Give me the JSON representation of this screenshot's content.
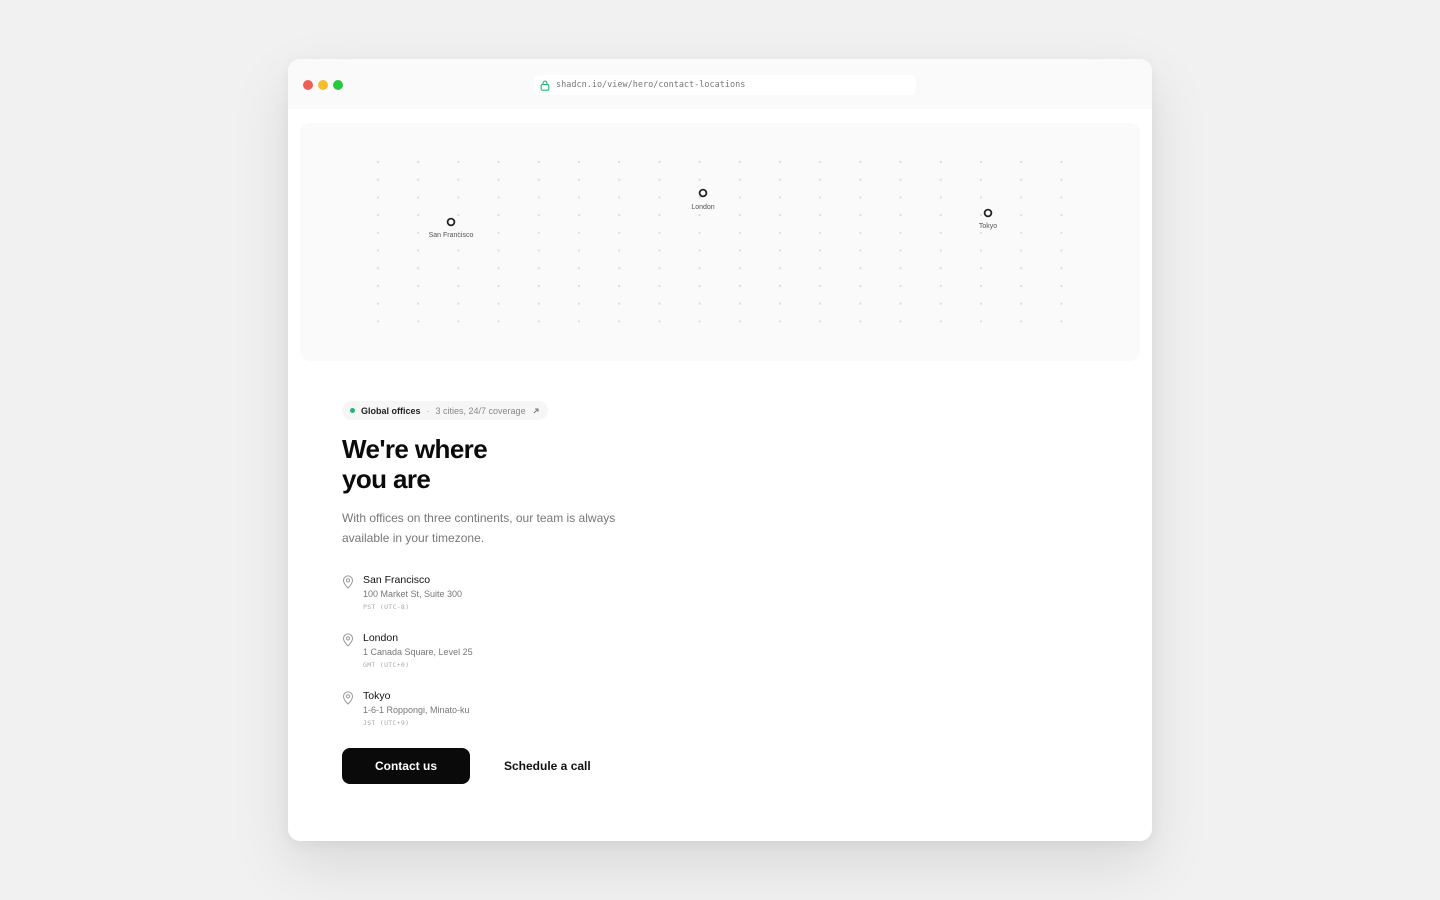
{
  "browser": {
    "url": "shadcn.io/view/hero/contact-locations"
  },
  "map": {
    "markers": [
      {
        "label": "San Francisco"
      },
      {
        "label": "London"
      },
      {
        "label": "Tokyo"
      }
    ]
  },
  "badge": {
    "tag": "Global offices",
    "separator": "·",
    "text": "3 cities, 24/7 coverage"
  },
  "hero": {
    "headline_line1": "We're where",
    "headline_line2": "you are",
    "subtext": "With offices on three continents, our team is always available in your timezone."
  },
  "locations": [
    {
      "name": "San Francisco",
      "address": "100 Market St, Suite 300",
      "timezone": "PST (UTC-8)"
    },
    {
      "name": "London",
      "address": "1 Canada Square, Level 25",
      "timezone": "GMT (UTC+0)"
    },
    {
      "name": "Tokyo",
      "address": "1-6-1 Roppongi, Minato-ku",
      "timezone": "JST (UTC+9)"
    }
  ],
  "actions": {
    "primary_label": "Contact us",
    "secondary_label": "Schedule a call"
  },
  "colors": {
    "window_controls": [
      "#ef5f57",
      "#f6bd2e",
      "#28c840"
    ],
    "status_dot": "#22b573",
    "primary_button": "#0a0a0a"
  }
}
